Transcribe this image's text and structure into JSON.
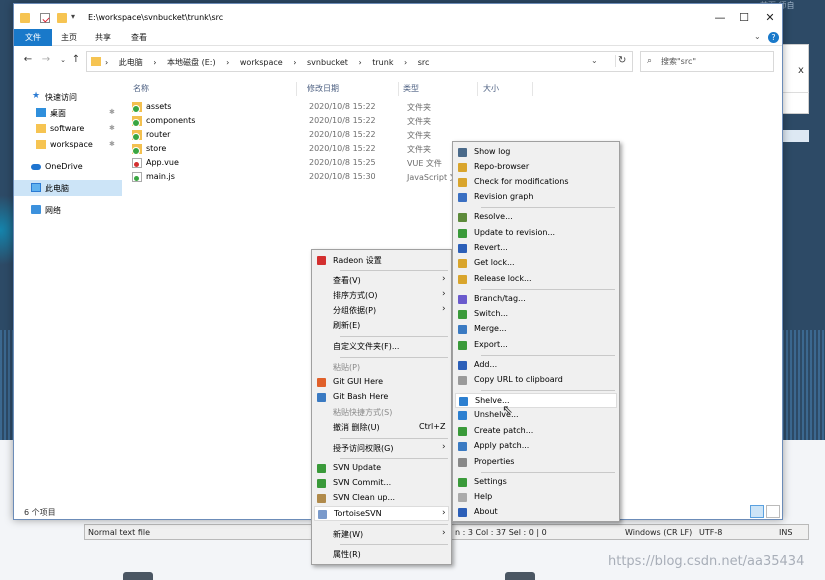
{
  "desktop": {
    "corner_text": "首页 师自",
    "watermark": "https://blog.csdn.net/aa35434"
  },
  "back_window": {
    "close": "x"
  },
  "editor_status": {
    "file_type": "Normal text file",
    "position": "n : 3    Col : 37    Sel : 0 | 0",
    "line_endings": "Windows (CR LF)",
    "encoding": "UTF-8",
    "mode": "INS"
  },
  "explorer": {
    "title": "E:\\workspace\\svnbucket\\trunk\\src",
    "window_buttons": {
      "minimize": "—",
      "maximize": "☐",
      "close": "✕"
    },
    "ribbon": {
      "tabs": [
        "文件",
        "主页",
        "共享",
        "查看"
      ],
      "help": "?"
    },
    "address": {
      "crumbs": [
        "›",
        "此电脑",
        "›",
        "本地磁盘 (E:)",
        "›",
        "workspace",
        "›",
        "svnbucket",
        "›",
        "trunk",
        "›",
        "src"
      ],
      "search_placeholder": "搜索\"src\""
    },
    "nav": [
      {
        "label": "快速访问"
      },
      {
        "label": "桌面"
      },
      {
        "label": "software"
      },
      {
        "label": "workspace"
      },
      {
        "label": "OneDrive"
      },
      {
        "label": "此电脑"
      },
      {
        "label": "网络"
      }
    ],
    "columns": {
      "name": "名称",
      "date": "修改日期",
      "type": "类型",
      "size": "大小"
    },
    "files": [
      {
        "name": "assets",
        "date": "2020/10/8 15:22",
        "type": "文件夹"
      },
      {
        "name": "components",
        "date": "2020/10/8 15:22",
        "type": "文件夹"
      },
      {
        "name": "router",
        "date": "2020/10/8 15:22",
        "type": "文件夹"
      },
      {
        "name": "store",
        "date": "2020/10/8 15:22",
        "type": "文件夹"
      },
      {
        "name": "App.vue",
        "date": "2020/10/8 15:25",
        "type": "VUE 文件"
      },
      {
        "name": "main.js",
        "date": "2020/10/8 15:30",
        "type": "JavaScript 文"
      }
    ],
    "status": {
      "count": "6 个项目"
    }
  },
  "context_menu": {
    "items": [
      {
        "label": "Radeon 设置"
      },
      {
        "label": "查看(V)"
      },
      {
        "label": "排序方式(O)"
      },
      {
        "label": "分组依据(P)"
      },
      {
        "label": "刷新(E)"
      },
      {
        "label": "自定义文件夹(F)..."
      },
      {
        "label": "粘贴(P)"
      },
      {
        "label": "Git GUI Here"
      },
      {
        "label": "Git Bash Here"
      },
      {
        "label": "粘贴快捷方式(S)"
      },
      {
        "label": "撤消 删除(U)",
        "shortcut": "Ctrl+Z"
      },
      {
        "label": "授予访问权限(G)"
      },
      {
        "label": "SVN Update"
      },
      {
        "label": "SVN Commit..."
      },
      {
        "label": "SVN Clean up..."
      },
      {
        "label": "TortoiseSVN"
      },
      {
        "label": "新建(W)"
      },
      {
        "label": "属性(R)"
      }
    ],
    "arrow": "›"
  },
  "svn_menu": {
    "items": [
      {
        "label": "Show log",
        "color": "#4a6a8a"
      },
      {
        "label": "Repo-browser",
        "color": "#d9a52c"
      },
      {
        "label": "Check for modifications",
        "color": "#d9a52c"
      },
      {
        "label": "Revision graph",
        "color": "#3a6fc2"
      },
      {
        "label": "Resolve...",
        "color": "#5c8a3a"
      },
      {
        "label": "Update to revision...",
        "color": "#3a9a3a"
      },
      {
        "label": "Revert...",
        "color": "#2c5fb8"
      },
      {
        "label": "Get lock...",
        "color": "#d9a52c"
      },
      {
        "label": "Release lock...",
        "color": "#d9a52c"
      },
      {
        "label": "Branch/tag...",
        "color": "#6a5acd"
      },
      {
        "label": "Switch...",
        "color": "#3a9a3a"
      },
      {
        "label": "Merge...",
        "color": "#3a7ac2"
      },
      {
        "label": "Export...",
        "color": "#3a9a3a"
      },
      {
        "label": "Add...",
        "color": "#2c5fb8"
      },
      {
        "label": "Copy URL to clipboard",
        "color": "#9a9a9a"
      },
      {
        "label": "Shelve...",
        "color": "#2c7fd0"
      },
      {
        "label": "Unshelve...",
        "color": "#2c7fd0"
      },
      {
        "label": "Create patch...",
        "color": "#3a9a3a"
      },
      {
        "label": "Apply patch...",
        "color": "#3a7ac2"
      },
      {
        "label": "Properties",
        "color": "#888888"
      },
      {
        "label": "Settings",
        "color": "#3a9a3a"
      },
      {
        "label": "Help",
        "color": "#aaaaaa"
      },
      {
        "label": "About",
        "color": "#2c5fb8"
      }
    ]
  }
}
